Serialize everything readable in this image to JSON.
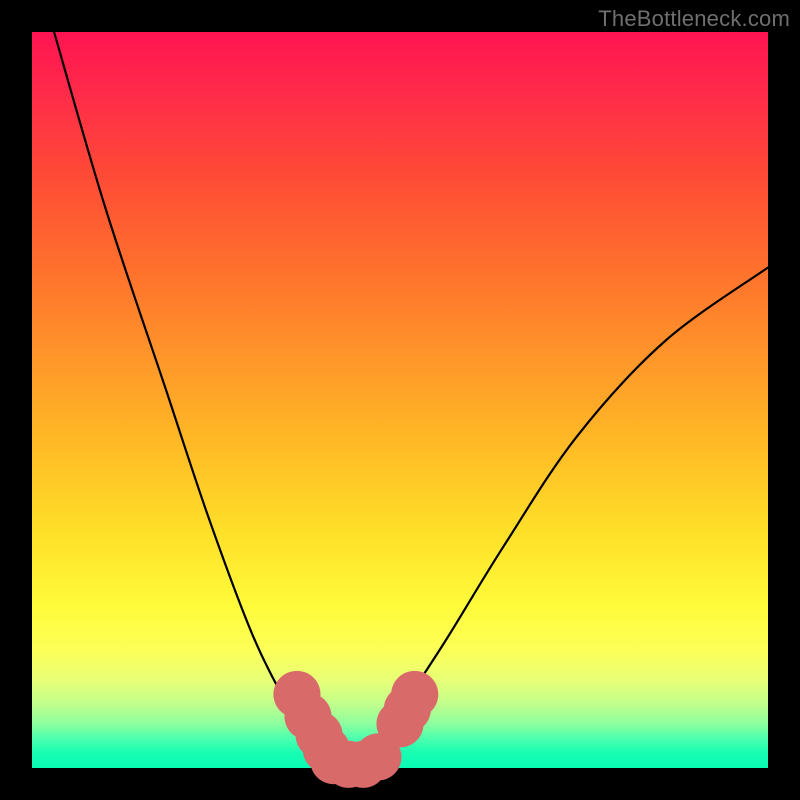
{
  "watermark": "TheBottleneck.com",
  "chart_data": {
    "type": "line",
    "title": "",
    "xlabel": "",
    "ylabel": "",
    "xlim": [
      0,
      100
    ],
    "ylim": [
      0,
      100
    ],
    "grid": false,
    "series": [
      {
        "name": "bottleneck-curve",
        "color": "#000000",
        "x": [
          3,
          10,
          18,
          24,
          30,
          35,
          38,
          40,
          42,
          44,
          46,
          50,
          56,
          64,
          74,
          86,
          100
        ],
        "y": [
          100,
          76,
          52,
          34,
          18,
          8,
          3,
          0.5,
          0,
          0.5,
          3,
          8,
          17,
          30,
          45,
          58,
          68
        ]
      }
    ],
    "markers": {
      "name": "optimal-zone-markers",
      "color": "#d86a6a",
      "radius": 3.2,
      "points": [
        {
          "x": 36,
          "y": 10
        },
        {
          "x": 37.5,
          "y": 7
        },
        {
          "x": 39,
          "y": 4.5
        },
        {
          "x": 40,
          "y": 2.5
        },
        {
          "x": 41,
          "y": 1
        },
        {
          "x": 43,
          "y": 0.5
        },
        {
          "x": 45,
          "y": 0.5
        },
        {
          "x": 47,
          "y": 1.5
        },
        {
          "x": 50,
          "y": 6
        },
        {
          "x": 51,
          "y": 8
        },
        {
          "x": 52,
          "y": 10
        }
      ]
    }
  }
}
